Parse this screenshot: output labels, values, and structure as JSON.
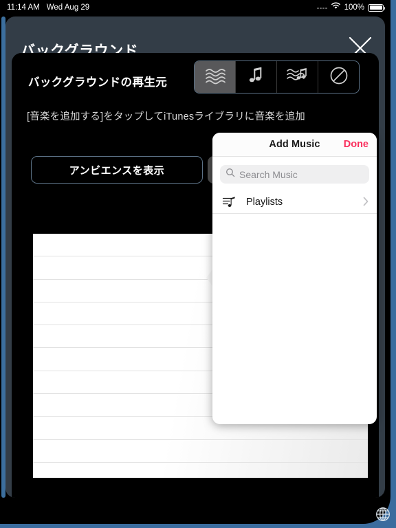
{
  "statusbar": {
    "time": "11:14 AM",
    "date": "Wed Aug 29",
    "battery_percent": "100%",
    "cellular_icon": "signal-dots-icon",
    "wifi_icon": "wifi-icon",
    "battery_icon": "battery-full-icon"
  },
  "panel": {
    "title": "バックグラウンド",
    "close_icon": "close-x-icon"
  },
  "section": {
    "heading": "バックグラウンドの再生元",
    "hint": "[音楽を追加する]をタップしてiTunesライブラリに音楽を追加"
  },
  "segmented_control": {
    "selected_index": 0,
    "options": [
      {
        "icon": "ambience-waves-icon",
        "label": "アンビエンス"
      },
      {
        "icon": "music-note-icon",
        "label": "ミュージック"
      },
      {
        "icon": "ambience-and-music-icon",
        "label": "アンビエンスとミュージック"
      },
      {
        "icon": "none-prohibited-icon",
        "label": "なし"
      }
    ]
  },
  "ambience_button": {
    "label": "アンビエンスを表示"
  },
  "popover": {
    "title": "Add Music",
    "done_label": "Done",
    "search": {
      "placeholder": "Search Music",
      "value": "",
      "icon": "search-icon"
    },
    "rows": [
      {
        "label": "Playlists",
        "icon": "playlist-icon",
        "accessory_icon": "chevron-right-icon"
      }
    ]
  },
  "list": {
    "row_count": 11
  },
  "footer": {
    "globe_icon": "globe-icon"
  },
  "colors": {
    "panel_bg": "#333d47",
    "content_bg": "#000000",
    "accent_pink": "#fa2f5d",
    "frame_blue": "#3b6c9e",
    "segment_selected": "#58585a",
    "segment_border": "#5c7287"
  }
}
